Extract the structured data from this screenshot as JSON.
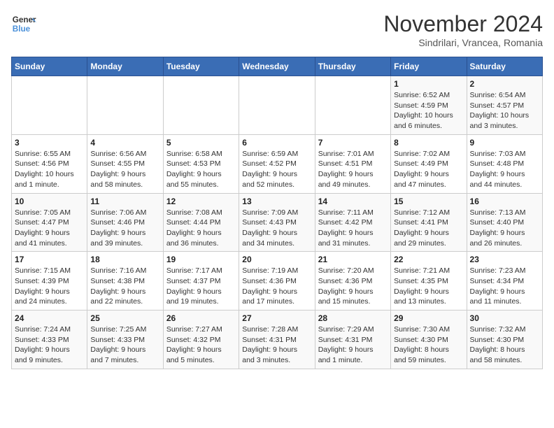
{
  "logo": {
    "line1": "General",
    "line2": "Blue"
  },
  "title": "November 2024",
  "subtitle": "Sindrilari, Vrancea, Romania",
  "weekdays": [
    "Sunday",
    "Monday",
    "Tuesday",
    "Wednesday",
    "Thursday",
    "Friday",
    "Saturday"
  ],
  "weeks": [
    [
      {
        "day": "",
        "info": ""
      },
      {
        "day": "",
        "info": ""
      },
      {
        "day": "",
        "info": ""
      },
      {
        "day": "",
        "info": ""
      },
      {
        "day": "",
        "info": ""
      },
      {
        "day": "1",
        "info": "Sunrise: 6:52 AM\nSunset: 4:59 PM\nDaylight: 10 hours\nand 6 minutes."
      },
      {
        "day": "2",
        "info": "Sunrise: 6:54 AM\nSunset: 4:57 PM\nDaylight: 10 hours\nand 3 minutes."
      }
    ],
    [
      {
        "day": "3",
        "info": "Sunrise: 6:55 AM\nSunset: 4:56 PM\nDaylight: 10 hours\nand 1 minute."
      },
      {
        "day": "4",
        "info": "Sunrise: 6:56 AM\nSunset: 4:55 PM\nDaylight: 9 hours\nand 58 minutes."
      },
      {
        "day": "5",
        "info": "Sunrise: 6:58 AM\nSunset: 4:53 PM\nDaylight: 9 hours\nand 55 minutes."
      },
      {
        "day": "6",
        "info": "Sunrise: 6:59 AM\nSunset: 4:52 PM\nDaylight: 9 hours\nand 52 minutes."
      },
      {
        "day": "7",
        "info": "Sunrise: 7:01 AM\nSunset: 4:51 PM\nDaylight: 9 hours\nand 49 minutes."
      },
      {
        "day": "8",
        "info": "Sunrise: 7:02 AM\nSunset: 4:49 PM\nDaylight: 9 hours\nand 47 minutes."
      },
      {
        "day": "9",
        "info": "Sunrise: 7:03 AM\nSunset: 4:48 PM\nDaylight: 9 hours\nand 44 minutes."
      }
    ],
    [
      {
        "day": "10",
        "info": "Sunrise: 7:05 AM\nSunset: 4:47 PM\nDaylight: 9 hours\nand 41 minutes."
      },
      {
        "day": "11",
        "info": "Sunrise: 7:06 AM\nSunset: 4:46 PM\nDaylight: 9 hours\nand 39 minutes."
      },
      {
        "day": "12",
        "info": "Sunrise: 7:08 AM\nSunset: 4:44 PM\nDaylight: 9 hours\nand 36 minutes."
      },
      {
        "day": "13",
        "info": "Sunrise: 7:09 AM\nSunset: 4:43 PM\nDaylight: 9 hours\nand 34 minutes."
      },
      {
        "day": "14",
        "info": "Sunrise: 7:11 AM\nSunset: 4:42 PM\nDaylight: 9 hours\nand 31 minutes."
      },
      {
        "day": "15",
        "info": "Sunrise: 7:12 AM\nSunset: 4:41 PM\nDaylight: 9 hours\nand 29 minutes."
      },
      {
        "day": "16",
        "info": "Sunrise: 7:13 AM\nSunset: 4:40 PM\nDaylight: 9 hours\nand 26 minutes."
      }
    ],
    [
      {
        "day": "17",
        "info": "Sunrise: 7:15 AM\nSunset: 4:39 PM\nDaylight: 9 hours\nand 24 minutes."
      },
      {
        "day": "18",
        "info": "Sunrise: 7:16 AM\nSunset: 4:38 PM\nDaylight: 9 hours\nand 22 minutes."
      },
      {
        "day": "19",
        "info": "Sunrise: 7:17 AM\nSunset: 4:37 PM\nDaylight: 9 hours\nand 19 minutes."
      },
      {
        "day": "20",
        "info": "Sunrise: 7:19 AM\nSunset: 4:36 PM\nDaylight: 9 hours\nand 17 minutes."
      },
      {
        "day": "21",
        "info": "Sunrise: 7:20 AM\nSunset: 4:36 PM\nDaylight: 9 hours\nand 15 minutes."
      },
      {
        "day": "22",
        "info": "Sunrise: 7:21 AM\nSunset: 4:35 PM\nDaylight: 9 hours\nand 13 minutes."
      },
      {
        "day": "23",
        "info": "Sunrise: 7:23 AM\nSunset: 4:34 PM\nDaylight: 9 hours\nand 11 minutes."
      }
    ],
    [
      {
        "day": "24",
        "info": "Sunrise: 7:24 AM\nSunset: 4:33 PM\nDaylight: 9 hours\nand 9 minutes."
      },
      {
        "day": "25",
        "info": "Sunrise: 7:25 AM\nSunset: 4:33 PM\nDaylight: 9 hours\nand 7 minutes."
      },
      {
        "day": "26",
        "info": "Sunrise: 7:27 AM\nSunset: 4:32 PM\nDaylight: 9 hours\nand 5 minutes."
      },
      {
        "day": "27",
        "info": "Sunrise: 7:28 AM\nSunset: 4:31 PM\nDaylight: 9 hours\nand 3 minutes."
      },
      {
        "day": "28",
        "info": "Sunrise: 7:29 AM\nSunset: 4:31 PM\nDaylight: 9 hours\nand 1 minute."
      },
      {
        "day": "29",
        "info": "Sunrise: 7:30 AM\nSunset: 4:30 PM\nDaylight: 8 hours\nand 59 minutes."
      },
      {
        "day": "30",
        "info": "Sunrise: 7:32 AM\nSunset: 4:30 PM\nDaylight: 8 hours\nand 58 minutes."
      }
    ]
  ]
}
